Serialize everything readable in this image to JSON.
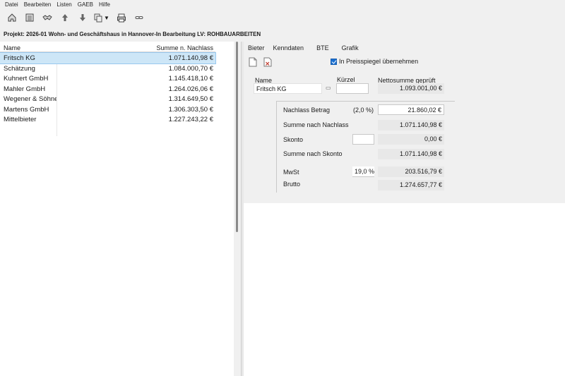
{
  "menu": [
    "Datei",
    "Bearbeiten",
    "Listen",
    "GAEB",
    "Hilfe"
  ],
  "toolbar": {
    "icons": [
      "home-icon",
      "list-icon",
      "handshake-icon",
      "arrow-up-icon",
      "arrow-down-icon",
      "copy-icon",
      "print-icon",
      "link-icon"
    ]
  },
  "project": {
    "title": "Projekt: 2026-01 Wohn- und Geschäftshaus in Hannover-In Bearbeitung  LV: ROHBAUARBEITEN"
  },
  "bidders": {
    "columns": [
      "Name",
      "Summe n. Nachlass"
    ],
    "rows": [
      {
        "name": "Fritsch KG",
        "sum": "1.071.140,98 €",
        "selected": true
      },
      {
        "name": "Schätzung",
        "sum": "1.084.000,70 €"
      },
      {
        "name": "Kuhnert GmbH",
        "sum": "1.145.418,10 €"
      },
      {
        "name": "Mahler GmbH",
        "sum": "1.264.026,06 €"
      },
      {
        "name": "Wegener & Söhne",
        "sum": "1.314.649,50 €"
      },
      {
        "name": "Martens GmbH",
        "sum": "1.306.303,50 €"
      },
      {
        "name": "Mittelbieter",
        "sum": "1.227.243,22 €"
      }
    ]
  },
  "tabs": [
    "Bieter",
    "Kenndaten",
    "BTE",
    "Grafik"
  ],
  "detail": {
    "checkbox_label": "In Preisspiegel übernehmen",
    "name_label": "Name",
    "name_value": "Fritsch KG",
    "kuerzel_label": "Kürzel",
    "kuerzel_value": "",
    "netto_label": "Nettosumme geprüft",
    "netto_value": "1.093.001,00 €",
    "nachlass_label": "Nachlass Betrag",
    "nachlass_pct": "(2,0 %)",
    "nachlass_value": "21.860,02 €",
    "summe_nachlass_label": "Summe nach Nachlass",
    "summe_nachlass_value": "1.071.140,98 €",
    "skonto_label": "Skonto",
    "skonto_input": "",
    "skonto_value": "0,00 €",
    "summe_skonto_label": "Summe nach Skonto",
    "summe_skonto_value": "1.071.140,98 €",
    "mwst_label": "MwSt",
    "mwst_pct": "19,0 %",
    "mwst_value": "203.516,79 €",
    "brutto_label": "Brutto",
    "brutto_value": "1.274.657,77 €"
  }
}
